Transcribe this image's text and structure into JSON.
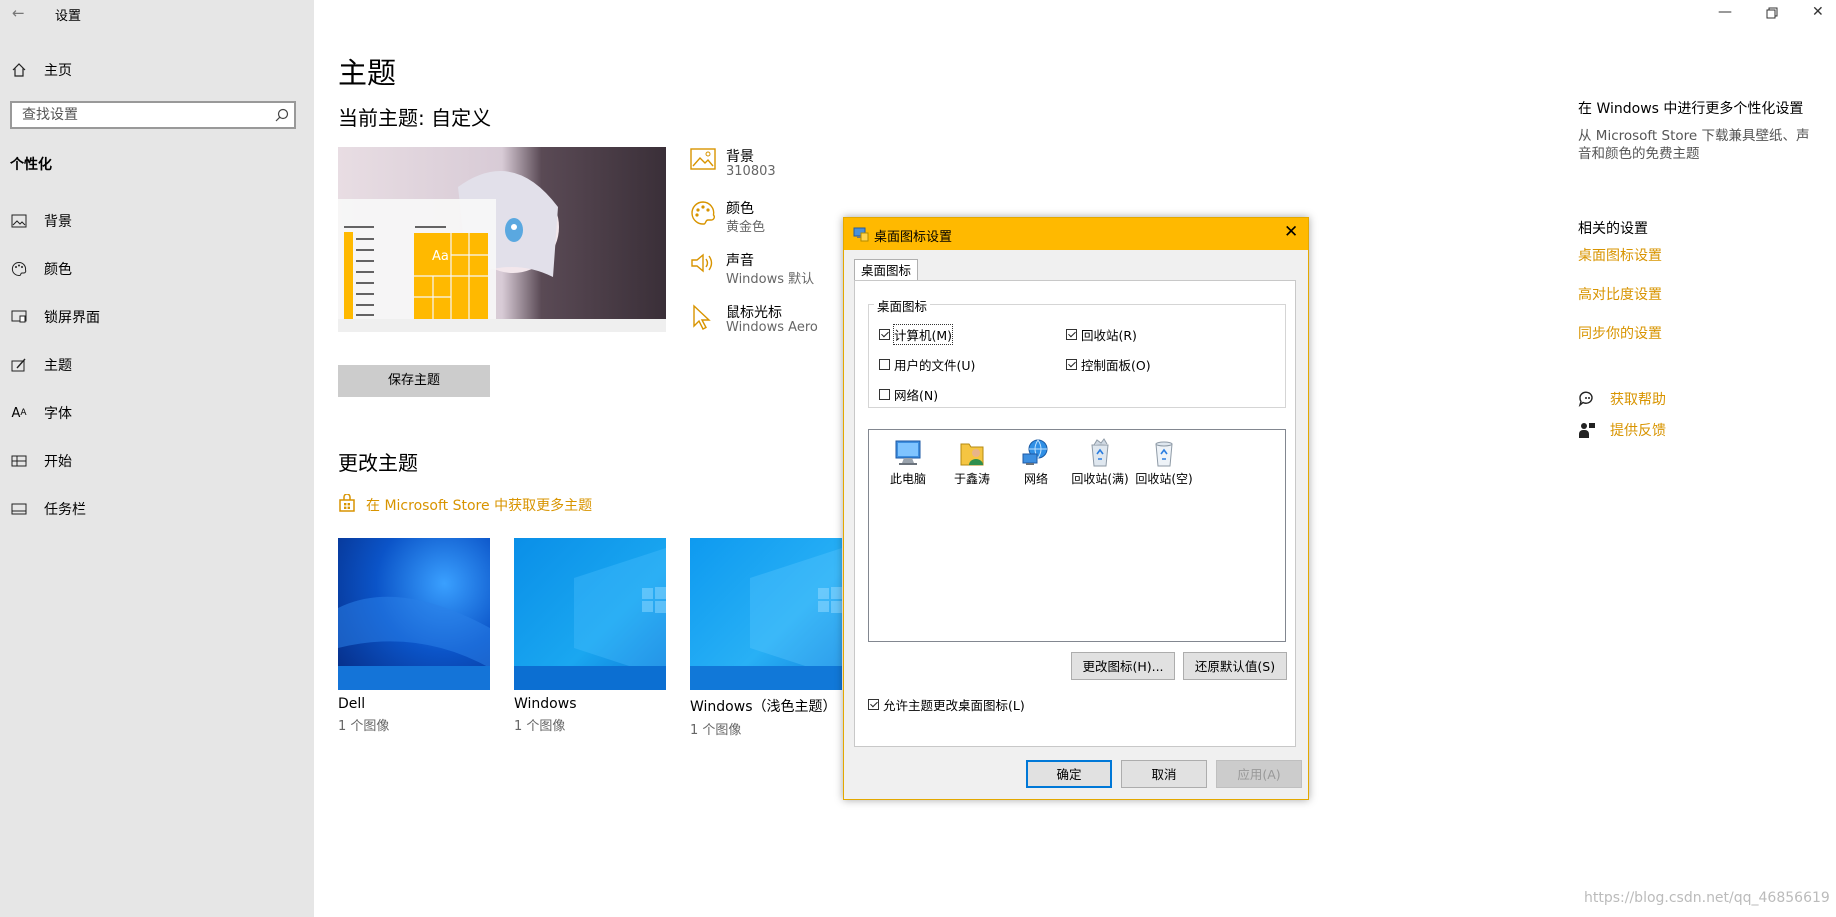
{
  "window": {
    "title": "设置",
    "back_icon": "arrow-left-icon",
    "minimize_icon": "minimize-icon",
    "restore_icon": "restore-icon",
    "close_icon": "close-icon"
  },
  "sidebar": {
    "home_label": "主页",
    "search_placeholder": "查找设置",
    "section_title": "个性化",
    "items": [
      {
        "label": "背景",
        "icon": "picture-icon"
      },
      {
        "label": "颜色",
        "icon": "palette-icon"
      },
      {
        "label": "锁屏界面",
        "icon": "lock-screen-icon"
      },
      {
        "label": "主题",
        "icon": "theme-icon"
      },
      {
        "label": "字体",
        "icon": "font-icon"
      },
      {
        "label": "开始",
        "icon": "start-icon"
      },
      {
        "label": "任务栏",
        "icon": "taskbar-icon"
      }
    ]
  },
  "main": {
    "title": "主题",
    "current_theme": "当前主题: 自定义",
    "preview_tile_text": "Aa",
    "props": [
      {
        "name": "背景",
        "value": "310803",
        "icon": "picture-icon"
      },
      {
        "name": "颜色",
        "value": "黄金色",
        "icon": "palette-icon"
      },
      {
        "name": "声音",
        "value": "Windows 默认",
        "icon": "speaker-icon"
      },
      {
        "name": "鼠标光标",
        "value": "Windows Aero",
        "icon": "cursor-icon"
      }
    ],
    "save_button": "保存主题",
    "change_theme_title": "更改主题",
    "store_link": "在 Microsoft Store 中获取更多主题",
    "themes": [
      {
        "name": "Dell",
        "count": "1 个图像"
      },
      {
        "name": "Windows",
        "count": "1 个图像"
      },
      {
        "name": "Windows（浅色主题）",
        "count": "1 个图像"
      }
    ]
  },
  "right_panel": {
    "title": "在 Windows 中进行更多个性化设置",
    "subtitle": "从 Microsoft Store 下载兼具壁纸、声音和颜色的免费主题",
    "related_title": "相关的设置",
    "related_links": [
      "桌面图标设置",
      "高对比度设置",
      "同步你的设置"
    ],
    "help_label": "获取帮助",
    "feedback_label": "提供反馈"
  },
  "dialog": {
    "title": "桌面图标设置",
    "tab": "桌面图标",
    "group_label": "桌面图标",
    "checkboxes": [
      {
        "label": "计算机(M)",
        "checked": true
      },
      {
        "label": "回收站(R)",
        "checked": true
      },
      {
        "label": "用户的文件(U)",
        "checked": false
      },
      {
        "label": "控制面板(O)",
        "checked": true
      },
      {
        "label": "网络(N)",
        "checked": false
      }
    ],
    "icons": [
      {
        "label": "此电脑",
        "icon": "computer-icon"
      },
      {
        "label": "于鑫涛",
        "icon": "user-folder-icon"
      },
      {
        "label": "网络",
        "icon": "network-icon"
      },
      {
        "label": "回收站(满)",
        "icon": "recycle-bin-full-icon"
      },
      {
        "label": "回收站(空)",
        "icon": "recycle-bin-empty-icon"
      }
    ],
    "change_icon_button": "更改图标(H)...",
    "restore_default_button": "还原默认值(S)",
    "allow_themes_checkbox": {
      "label": "允许主题更改桌面图标(L)",
      "checked": true
    },
    "ok_button": "确定",
    "cancel_button": "取消",
    "apply_button": "应用(A)"
  },
  "colors": {
    "accent": "#ffb900",
    "link": "#d89400",
    "sidebar_bg": "#e6e6e6"
  },
  "watermark": "https://blog.csdn.net/qq_46856619"
}
